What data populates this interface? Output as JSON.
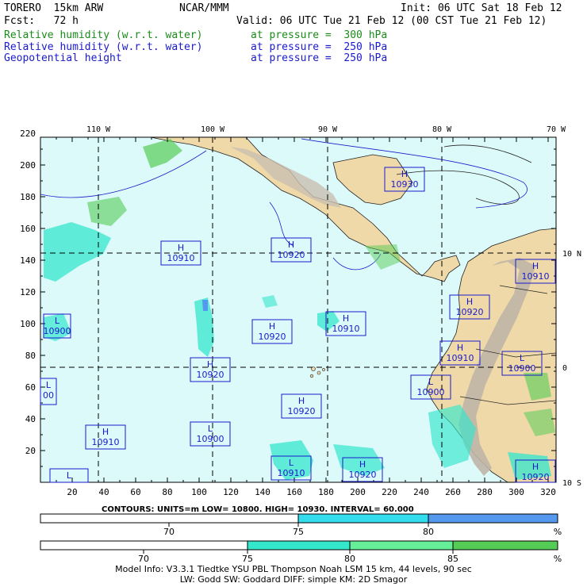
{
  "header": {
    "model": "TORERO  15km ARW",
    "org": "NCAR/MMM",
    "init": "Init: 06 UTC Sat 18 Feb 12",
    "fcst": "Fcst:   72 h",
    "valid": "Valid: 06 UTC Tue 21 Feb 12 (00 CST Tue 21 Feb 12)",
    "fields": [
      {
        "name": "Relative humidity (w.r.t. water)",
        "level": "at pressure =  300 hPa",
        "color": "#1a8c1a"
      },
      {
        "name": "Relative humidity (w.r.t. water)",
        "level": "at pressure =  250 hPa",
        "color": "#1a1acc"
      },
      {
        "name": "Geopotential height",
        "level": "at pressure =  250 hPa",
        "color": "#1a1acc"
      }
    ]
  },
  "map": {
    "lon_labels": [
      "110 W",
      "100 W",
      "90 W",
      "80 W",
      "70 W"
    ],
    "lat_labels": [
      "10 N",
      "0",
      "10 S"
    ],
    "x_ticks": [
      "20",
      "40",
      "60",
      "80",
      "100",
      "120",
      "140",
      "160",
      "180",
      "200",
      "220",
      "240",
      "260",
      "280",
      "300",
      "320"
    ],
    "y_ticks": [
      "220",
      "200",
      "180",
      "160",
      "140",
      "120",
      "100",
      "80",
      "60",
      "40",
      "20"
    ],
    "highs_lows": [
      {
        "type": "H",
        "value": "10930"
      },
      {
        "type": "H",
        "value": "10910"
      },
      {
        "type": "H",
        "value": "10920"
      },
      {
        "type": "H",
        "value": "10910"
      },
      {
        "type": "L",
        "value": "10900"
      },
      {
        "type": "H",
        "value": "10920"
      },
      {
        "type": "H",
        "value": "10910"
      },
      {
        "type": "H",
        "value": "10920"
      },
      {
        "type": "H",
        "value": "10920"
      },
      {
        "type": "H",
        "value": "10910"
      },
      {
        "type": "L",
        "value": "10900"
      },
      {
        "type": "L",
        "value": "10900"
      },
      {
        "type": "L",
        "value": "00"
      },
      {
        "type": "H",
        "value": "10920"
      },
      {
        "type": "H",
        "value": "10910"
      },
      {
        "type": "L",
        "value": "10900"
      },
      {
        "type": "L",
        "value": "10910"
      },
      {
        "type": "H",
        "value": "10920"
      },
      {
        "type": "L",
        "value": ""
      },
      {
        "type": "H",
        "value": "10920"
      }
    ]
  },
  "contours": "CONTOURS:  UNITS=m  LOW=  10800.     HIGH=  10930.    INTERVAL=   60.000",
  "colorbar_250": {
    "ticks": [
      "70",
      "75",
      "80",
      "%"
    ],
    "colors": [
      "#ffffff",
      "#33ddee",
      "#5599ee"
    ]
  },
  "colorbar_300": {
    "ticks": [
      "70",
      "75",
      "80",
      "85",
      "%"
    ],
    "colors": [
      "#ffffff",
      "#33e6cc",
      "#66ee99",
      "#55cc55"
    ]
  },
  "footer": {
    "line1": "Model Info: V3.3.1   Tiedtke YSU PBL  Thompson   Noah LSM  15 km,   44 levels,   90 sec",
    "line2": "LW: Godd SW: Goddard DIFF: simple KM: 2D Smagor"
  }
}
